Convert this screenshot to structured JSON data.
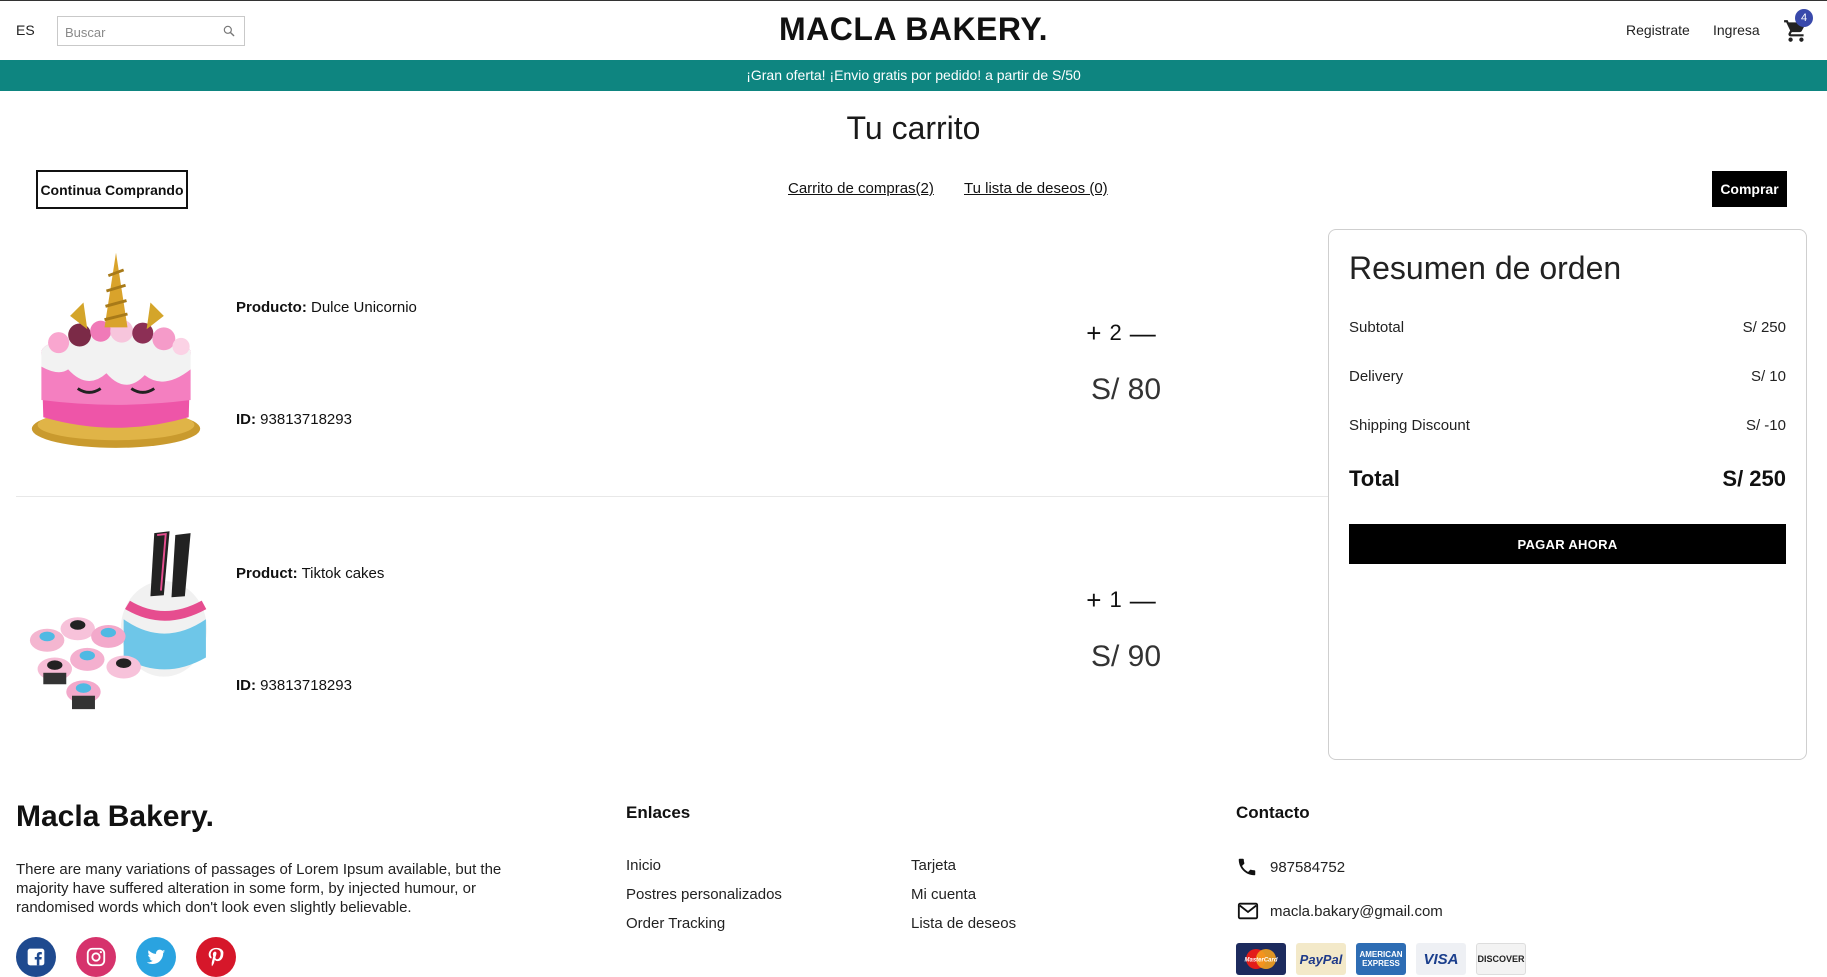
{
  "header": {
    "language": "ES",
    "search_placeholder": "Buscar",
    "brand": "MACLA BAKERY.",
    "register": "Registrate",
    "login": "Ingresa",
    "cart_count": "4"
  },
  "promo": "¡Gran oferta! ¡Envio gratis por pedido! a partir de S/50",
  "page": {
    "title": "Tu carrito",
    "continue_label": "Continua Comprando",
    "cart_tab": "Carrito de compras(2)",
    "wishlist_tab": "Tu lista de deseos (0)",
    "buy_label": "Comprar"
  },
  "items": [
    {
      "name_label": "Producto:",
      "name": "Dulce Unicornio",
      "id_label": "ID:",
      "id": "93813718293",
      "plus": "+",
      "quantity": "2",
      "minus": "—",
      "price": "S/ 80"
    },
    {
      "name_label": "Product:",
      "name": "Tiktok cakes",
      "id_label": "ID:",
      "id": "93813718293",
      "plus": "+",
      "quantity": "1",
      "minus": "—",
      "price": "S/ 90"
    }
  ],
  "summary": {
    "title": "Resumen de orden",
    "rows": [
      {
        "label": "Subtotal",
        "value": "S/ 250"
      },
      {
        "label": "Delivery",
        "value": "S/ 10"
      },
      {
        "label": "Shipping Discount",
        "value": "S/ -10"
      }
    ],
    "total_label": "Total",
    "total_value": "S/ 250",
    "pay_label": "PAGAR AHORA"
  },
  "footer": {
    "brand": "Macla Bakery.",
    "text": "There are many variations of passages of Lorem Ipsum available, but the majority have suffered alteration in some form, by injected humour, or randomised words which don't look even slightly believable.",
    "links_title": "Enlaces",
    "links_col1": [
      "Inicio",
      "Postres personalizados",
      "Order Tracking"
    ],
    "links_col2": [
      "Tarjeta",
      "Mi cuenta",
      "Lista de deseos"
    ],
    "contact_title": "Contacto",
    "phone": "987584752",
    "email": "macla.bakary@gmail.com",
    "social_colors": {
      "facebook": "#1f4a8f",
      "instagram": "#d6336c",
      "twitter": "#2aa3e0",
      "pinterest": "#d6172a"
    },
    "payment_cards": {
      "mastercard": "MasterCard",
      "paypal": "PayPal",
      "amex_line1": "AMERICAN",
      "amex_line2": "EXPRESS",
      "visa": "VISA",
      "discover": "DISCOVER"
    }
  },
  "colors": {
    "promo_bar": "#0e8580",
    "badge": "#3949ab",
    "buttons": "#000000"
  }
}
